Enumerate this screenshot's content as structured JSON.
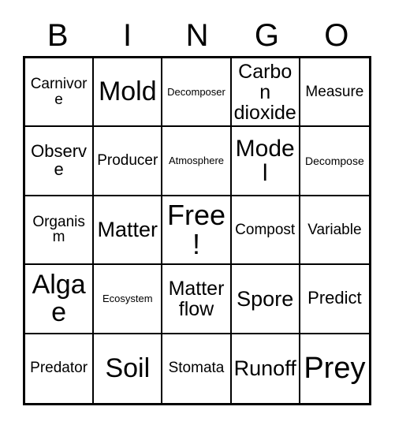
{
  "card": {
    "header_letters": [
      "B",
      "I",
      "N",
      "G",
      "O"
    ],
    "grid_size": "5x5",
    "colors": {
      "background": "#ffffff",
      "text": "#000000",
      "border": "#000000"
    },
    "cells": [
      {
        "label": "Carnivore",
        "size": "m",
        "free": false
      },
      {
        "label": "Mold",
        "size": "h2",
        "free": false
      },
      {
        "label": "Decomposer",
        "size": "xs",
        "free": false
      },
      {
        "label": "Carbon dioxide",
        "size": "xl",
        "free": false
      },
      {
        "label": "Measure",
        "size": "m",
        "free": false
      },
      {
        "label": "Observe",
        "size": "l",
        "free": false
      },
      {
        "label": "Producer",
        "size": "m",
        "free": false
      },
      {
        "label": "Atmosphere",
        "size": "xs",
        "free": false
      },
      {
        "label": "Model",
        "size": "h1",
        "free": false
      },
      {
        "label": "Decompose",
        "size": "s",
        "free": false
      },
      {
        "label": "Organism",
        "size": "m",
        "free": false
      },
      {
        "label": "Matter",
        "size": "xxl",
        "free": false
      },
      {
        "label": "Free!",
        "size": "h3",
        "free": true
      },
      {
        "label": "Compost",
        "size": "m",
        "free": false
      },
      {
        "label": "Variable",
        "size": "m",
        "free": false
      },
      {
        "label": "Algae",
        "size": "h2",
        "free": false
      },
      {
        "label": "Ecosystem",
        "size": "xs",
        "free": false
      },
      {
        "label": "Matter flow",
        "size": "xl",
        "free": false
      },
      {
        "label": "Spore",
        "size": "xxl",
        "free": false
      },
      {
        "label": "Predict",
        "size": "l",
        "free": false
      },
      {
        "label": "Predator",
        "size": "m",
        "free": false
      },
      {
        "label": "Soil",
        "size": "h2",
        "free": false
      },
      {
        "label": "Stomata",
        "size": "m",
        "free": false
      },
      {
        "label": "Runoff",
        "size": "xxl",
        "free": false
      },
      {
        "label": "Prey",
        "size": "h4",
        "free": false
      }
    ]
  }
}
